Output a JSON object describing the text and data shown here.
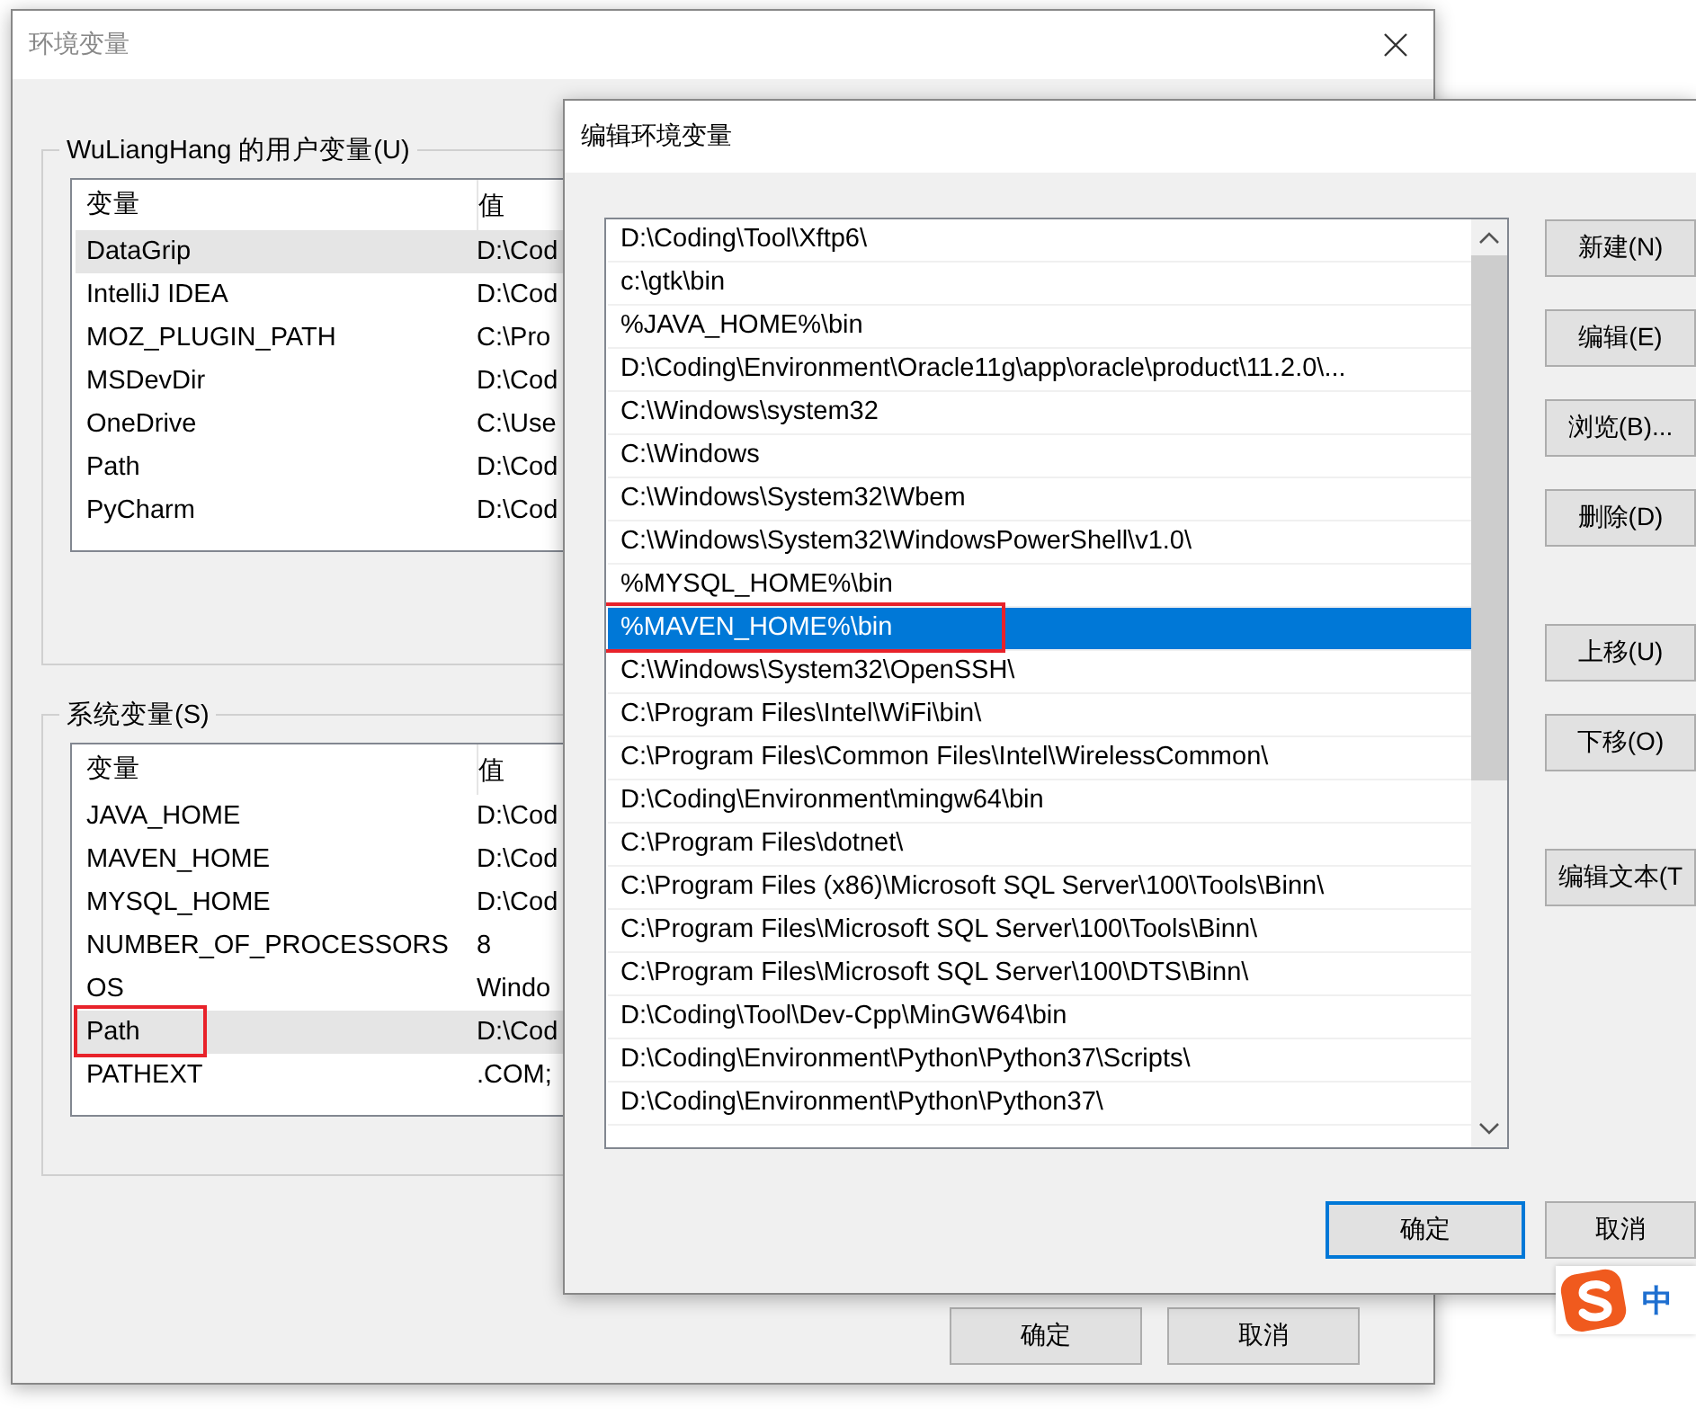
{
  "main_window": {
    "title": "环境变量",
    "user_group": {
      "label": "WuLiangHang 的用户变量(U)",
      "columns": [
        "变量",
        "值"
      ],
      "rows": [
        {
          "name": "DataGrip",
          "value": "D:\\Cod",
          "selected": true,
          "annotated": false
        },
        {
          "name": "IntelliJ IDEA",
          "value": "D:\\Cod",
          "selected": false,
          "annotated": false
        },
        {
          "name": "MOZ_PLUGIN_PATH",
          "value": "C:\\Pro",
          "selected": false,
          "annotated": false
        },
        {
          "name": "MSDevDir",
          "value": "D:\\Cod",
          "selected": false,
          "annotated": false
        },
        {
          "name": "OneDrive",
          "value": "C:\\Use",
          "selected": false,
          "annotated": false
        },
        {
          "name": "Path",
          "value": "D:\\Cod",
          "selected": false,
          "annotated": false
        },
        {
          "name": "PyCharm",
          "value": "D:\\Cod",
          "selected": false,
          "annotated": false
        }
      ]
    },
    "system_group": {
      "label": "系统变量(S)",
      "columns": [
        "变量",
        "值"
      ],
      "rows": [
        {
          "name": "JAVA_HOME",
          "value": "D:\\Cod",
          "selected": false,
          "annotated": false
        },
        {
          "name": "MAVEN_HOME",
          "value": "D:\\Cod",
          "selected": false,
          "annotated": false
        },
        {
          "name": "MYSQL_HOME",
          "value": "D:\\Cod",
          "selected": false,
          "annotated": false
        },
        {
          "name": "NUMBER_OF_PROCESSORS",
          "value": "8",
          "selected": false,
          "annotated": false
        },
        {
          "name": "OS",
          "value": "Windo",
          "selected": false,
          "annotated": false
        },
        {
          "name": "Path",
          "value": "D:\\Cod",
          "selected": true,
          "annotated": true
        },
        {
          "name": "PATHEXT",
          "value": ".COM;",
          "selected": false,
          "annotated": false
        }
      ]
    },
    "buttons": [
      {
        "label": "确定"
      },
      {
        "label": "取消"
      }
    ]
  },
  "edit_window": {
    "title": "编辑环境变量",
    "paths": [
      {
        "text": "D:\\Coding\\Tool\\Xftp6\\",
        "selected": false,
        "annotated": false
      },
      {
        "text": "c:\\gtk\\bin",
        "selected": false,
        "annotated": false
      },
      {
        "text": "%JAVA_HOME%\\bin",
        "selected": false,
        "annotated": false
      },
      {
        "text": "D:\\Coding\\Environment\\Oracle11g\\app\\oracle\\product\\11.2.0\\...",
        "selected": false,
        "annotated": false
      },
      {
        "text": "C:\\Windows\\system32",
        "selected": false,
        "annotated": false
      },
      {
        "text": "C:\\Windows",
        "selected": false,
        "annotated": false
      },
      {
        "text": "C:\\Windows\\System32\\Wbem",
        "selected": false,
        "annotated": false
      },
      {
        "text": "C:\\Windows\\System32\\WindowsPowerShell\\v1.0\\",
        "selected": false,
        "annotated": false
      },
      {
        "text": "%MYSQL_HOME%\\bin",
        "selected": false,
        "annotated": false
      },
      {
        "text": "%MAVEN_HOME%\\bin",
        "selected": true,
        "annotated": true
      },
      {
        "text": "C:\\Windows\\System32\\OpenSSH\\",
        "selected": false,
        "annotated": false
      },
      {
        "text": "C:\\Program Files\\Intel\\WiFi\\bin\\",
        "selected": false,
        "annotated": false
      },
      {
        "text": "C:\\Program Files\\Common Files\\Intel\\WirelessCommon\\",
        "selected": false,
        "annotated": false
      },
      {
        "text": "D:\\Coding\\Environment\\mingw64\\bin",
        "selected": false,
        "annotated": false
      },
      {
        "text": "C:\\Program Files\\dotnet\\",
        "selected": false,
        "annotated": false
      },
      {
        "text": "C:\\Program Files (x86)\\Microsoft SQL Server\\100\\Tools\\Binn\\",
        "selected": false,
        "annotated": false
      },
      {
        "text": "C:\\Program Files\\Microsoft SQL Server\\100\\Tools\\Binn\\",
        "selected": false,
        "annotated": false
      },
      {
        "text": "C:\\Program Files\\Microsoft SQL Server\\100\\DTS\\Binn\\",
        "selected": false,
        "annotated": false
      },
      {
        "text": "D:\\Coding\\Tool\\Dev-Cpp\\MinGW64\\bin",
        "selected": false,
        "annotated": false
      },
      {
        "text": "D:\\Coding\\Environment\\Python\\Python37\\Scripts\\",
        "selected": false,
        "annotated": false
      },
      {
        "text": "D:\\Coding\\Environment\\Python\\Python37\\",
        "selected": false,
        "annotated": false
      }
    ],
    "side_button_groups": [
      [
        {
          "label": "新建(N)"
        },
        {
          "label": "编辑(E)"
        },
        {
          "label": "浏览(B)..."
        },
        {
          "label": "删除(D)"
        }
      ],
      [
        {
          "label": "上移(U)"
        },
        {
          "label": "下移(O)"
        }
      ],
      [
        {
          "label": "编辑文本(T"
        }
      ]
    ],
    "buttons": [
      {
        "label": "确定",
        "default": true
      },
      {
        "label": "取消",
        "default": false
      }
    ]
  },
  "ime_indicator": {
    "mode": "中"
  }
}
